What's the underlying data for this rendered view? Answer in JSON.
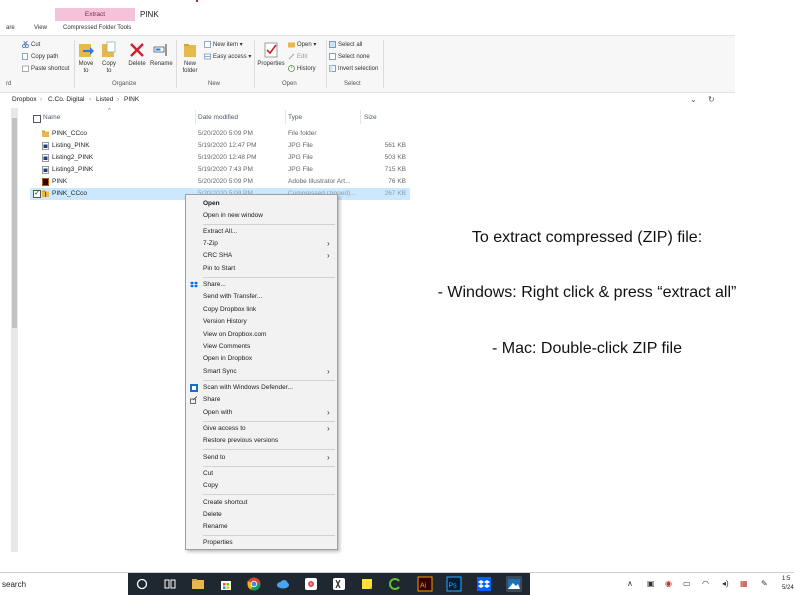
{
  "window": {
    "context_tab": "Extract",
    "title": "PINK"
  },
  "ribbon_tabs": [
    "are",
    "View",
    "Compressed Folder Tools"
  ],
  "ribbon": {
    "clipboard": {
      "cut": "Cut",
      "copy_path": "Copy path",
      "paste_shortcut": "Paste shortcut",
      "group_label": "rd"
    },
    "organize": {
      "move_to": "Move to",
      "copy_to": "Copy to",
      "delete": "Delete",
      "rename": "Rename",
      "group_label": "Organize"
    },
    "new": {
      "new_folder": "New folder",
      "new_item": "New item",
      "easy_access": "Easy access",
      "group_label": "New"
    },
    "open": {
      "properties": "Properties",
      "open": "Open",
      "edit": "Edit",
      "history": "History",
      "group_label": "Open"
    },
    "select": {
      "select_all": "Select all",
      "select_none": "Select none",
      "invert_selection": "Invert selection",
      "group_label": "Select"
    }
  },
  "breadcrumb": [
    "Dropbox",
    "C.Co. Digital",
    "Listed",
    "PINK"
  ],
  "columns": {
    "name": "Name",
    "date_modified": "Date modified",
    "type": "Type",
    "size": "Size"
  },
  "files": [
    {
      "name": "PINK_CCco",
      "date": "5/20/2020 5:09 PM",
      "type": "File folder",
      "size": "",
      "icon": "folder-icon",
      "selected": false
    },
    {
      "name": "Listing_PINK",
      "date": "5/19/2020 12:47 PM",
      "type": "JPG File",
      "size": "561 KB",
      "icon": "image-file-icon",
      "selected": false
    },
    {
      "name": "Listing2_PINK",
      "date": "5/19/2020 12:48 PM",
      "type": "JPG File",
      "size": "503 KB",
      "icon": "image-file-icon",
      "selected": false
    },
    {
      "name": "Listing3_PINK",
      "date": "5/19/2020 7:43 PM",
      "type": "JPG File",
      "size": "715 KB",
      "icon": "image-file-icon",
      "selected": false
    },
    {
      "name": "PINK",
      "date": "5/20/2020 5:09 PM",
      "type": "Adobe Illustrator Art...",
      "size": "76 KB",
      "icon": "illustrator-file-icon",
      "selected": false
    },
    {
      "name": "PINK_CCco",
      "date": "5/20/2020 5:09 PM",
      "type": "Compressed (zipped)...",
      "size": "267 KB",
      "icon": "zip-folder-icon",
      "selected": true
    }
  ],
  "context_menu": {
    "open": "Open",
    "open_new_window": "Open in new window",
    "extract_all": "Extract All...",
    "seven_zip": "7-Zip",
    "crc_sha": "CRC SHA",
    "pin_to_start": "Pin to Start",
    "share_dropbox": "Share...",
    "send_with_transfer": "Send with Transfer...",
    "copy_dropbox_link": "Copy Dropbox link",
    "version_history": "Version History",
    "view_on_dropbox": "View on Dropbox.com",
    "view_comments": "View Comments",
    "open_in_dropbox": "Open in Dropbox",
    "smart_sync": "Smart Sync",
    "scan_defender": "Scan with Windows Defender...",
    "share": "Share",
    "open_with": "Open with",
    "give_access": "Give access to",
    "restore_versions": "Restore previous versions",
    "send_to": "Send to",
    "cut": "Cut",
    "copy": "Copy",
    "create_shortcut": "Create shortcut",
    "delete": "Delete",
    "rename": "Rename",
    "properties": "Properties"
  },
  "instructions": {
    "heading": "To extract compressed (ZIP) file:",
    "windows": "- Windows: Right click & press “extract all”",
    "mac": "- Mac: Double-click ZIP file"
  },
  "taskbar": {
    "search": "search",
    "clock_time": "1:5",
    "clock_date": "5/24"
  },
  "colors": {
    "extract_tab": "#f4c3d9",
    "selection": "#cce8ff",
    "taskbar": "#1f2731",
    "folder": "#e8b84a",
    "illustrator": "#ff9a00",
    "photoshop": "#31a8ff",
    "dropbox": "#0061fe"
  }
}
